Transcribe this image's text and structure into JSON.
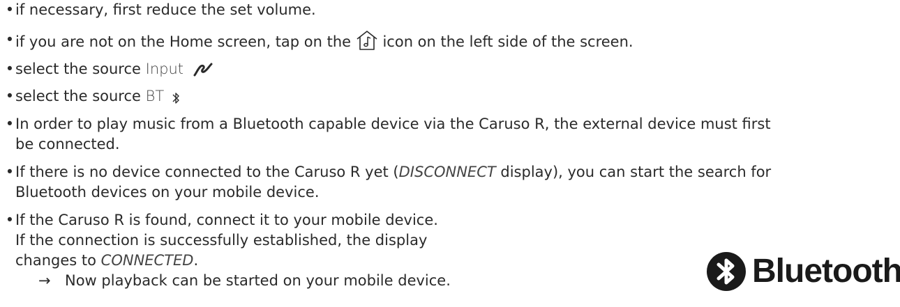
{
  "items": [
    {
      "text": "if necessary, first reduce the set volume."
    },
    {
      "pre": "if you are not on the Home screen, tap on the",
      "icon": "home-music-icon",
      "post": "icon on the left side of the screen."
    },
    {
      "pre": "select the source ",
      "source": "Input",
      "icon": "input-cable-icon"
    },
    {
      "pre": "select the source ",
      "source": "BT",
      "icon": "bluetooth-symbol-icon"
    },
    {
      "line1": "In order to play music from a Bluetooth capable device via the Caruso R, the external device must first",
      "line2": "be connected."
    },
    {
      "line1_pre": "If there is no device connected to the Caruso R yet (",
      "line1_term": "DISCONNECT",
      "line1_post": " display), you can start the search for",
      "line2": "Bluetooth devices on your mobile device."
    },
    {
      "line1": "If the Caruso R is found, connect it to your mobile device.",
      "line2": "If the connection is successfully established, the display",
      "line3_pre": "changes to ",
      "line3_term": "CONNECTED",
      "line3_post": "."
    }
  ],
  "result": {
    "arrow": "→",
    "text": "Now playback can be started on your mobile device."
  },
  "logo": {
    "word": "Bluetooth",
    "icon": "bluetooth-logo-icon"
  },
  "bullet_char": "•"
}
